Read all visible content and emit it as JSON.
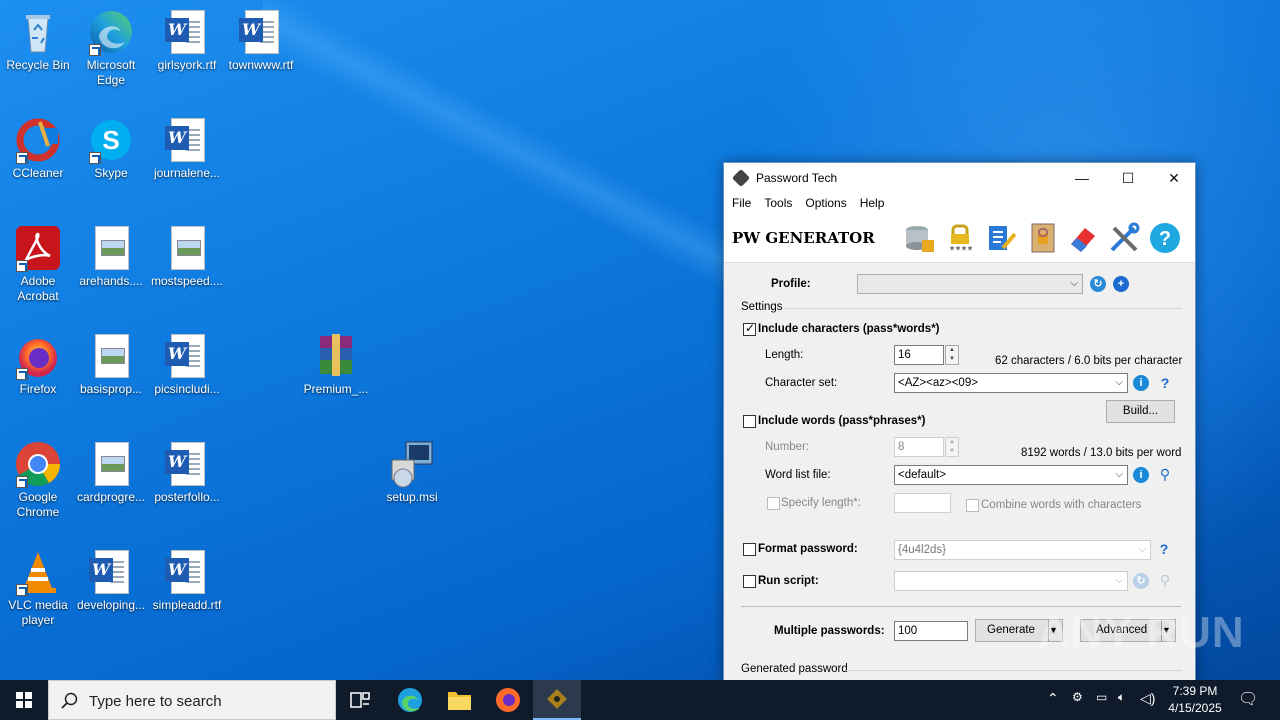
{
  "desktop": {
    "icons": [
      {
        "label": "Recycle Bin"
      },
      {
        "label": "Microsoft Edge"
      },
      {
        "label": "girlsyork.rtf"
      },
      {
        "label": "townwww.rtf"
      },
      {
        "label": "CCleaner"
      },
      {
        "label": "Skype"
      },
      {
        "label": "journalene..."
      },
      {
        "label": "Adobe Acrobat"
      },
      {
        "label": "arehands...."
      },
      {
        "label": "mostspeed...."
      },
      {
        "label": "Firefox"
      },
      {
        "label": "basisprop..."
      },
      {
        "label": "picsincludi..."
      },
      {
        "label": "Premium_..."
      },
      {
        "label": "Google Chrome"
      },
      {
        "label": "cardprogre..."
      },
      {
        "label": "posterfollo..."
      },
      {
        "label": "setup.msi"
      },
      {
        "label": "VLC media player"
      },
      {
        "label": "developing..."
      },
      {
        "label": "simpleadd.rtf"
      }
    ]
  },
  "window": {
    "title": "Password Tech",
    "menu": [
      "File",
      "Tools",
      "Options",
      "Help"
    ],
    "brand": "PW GENERATOR",
    "profile_label": "Profile:",
    "profile_value": "",
    "settings_label": "Settings",
    "include_chars_label": "Include characters (pass*words*)",
    "length_label": "Length:",
    "length_value": "16",
    "chars_info": "62 characters / 6.0 bits per character",
    "charset_label": "Character set:",
    "charset_value": "<AZ><az><09>",
    "build_label": "Build...",
    "include_words_label": "Include words (pass*phrases*)",
    "number_label": "Number:",
    "number_value": "8",
    "words_info": "8192 words / 13.0 bits per word",
    "wordlist_label": "Word list file:",
    "wordlist_value": "<default>",
    "specify_length_label": "Specify length*:",
    "combine_label": "Combine words with characters",
    "format_label": "Format password:",
    "format_value": "{4u4l2ds}",
    "script_label": "Run script:",
    "multiple_label": "Multiple passwords:",
    "multiple_value": "100",
    "generate_label": "Generate",
    "advanced_label": "Advanced",
    "generated_label": "Generated password"
  },
  "taskbar": {
    "search_placeholder": "Type here to search",
    "time": "7:39 PM",
    "date": "4/15/2025"
  },
  "watermark": "ANY RUN"
}
